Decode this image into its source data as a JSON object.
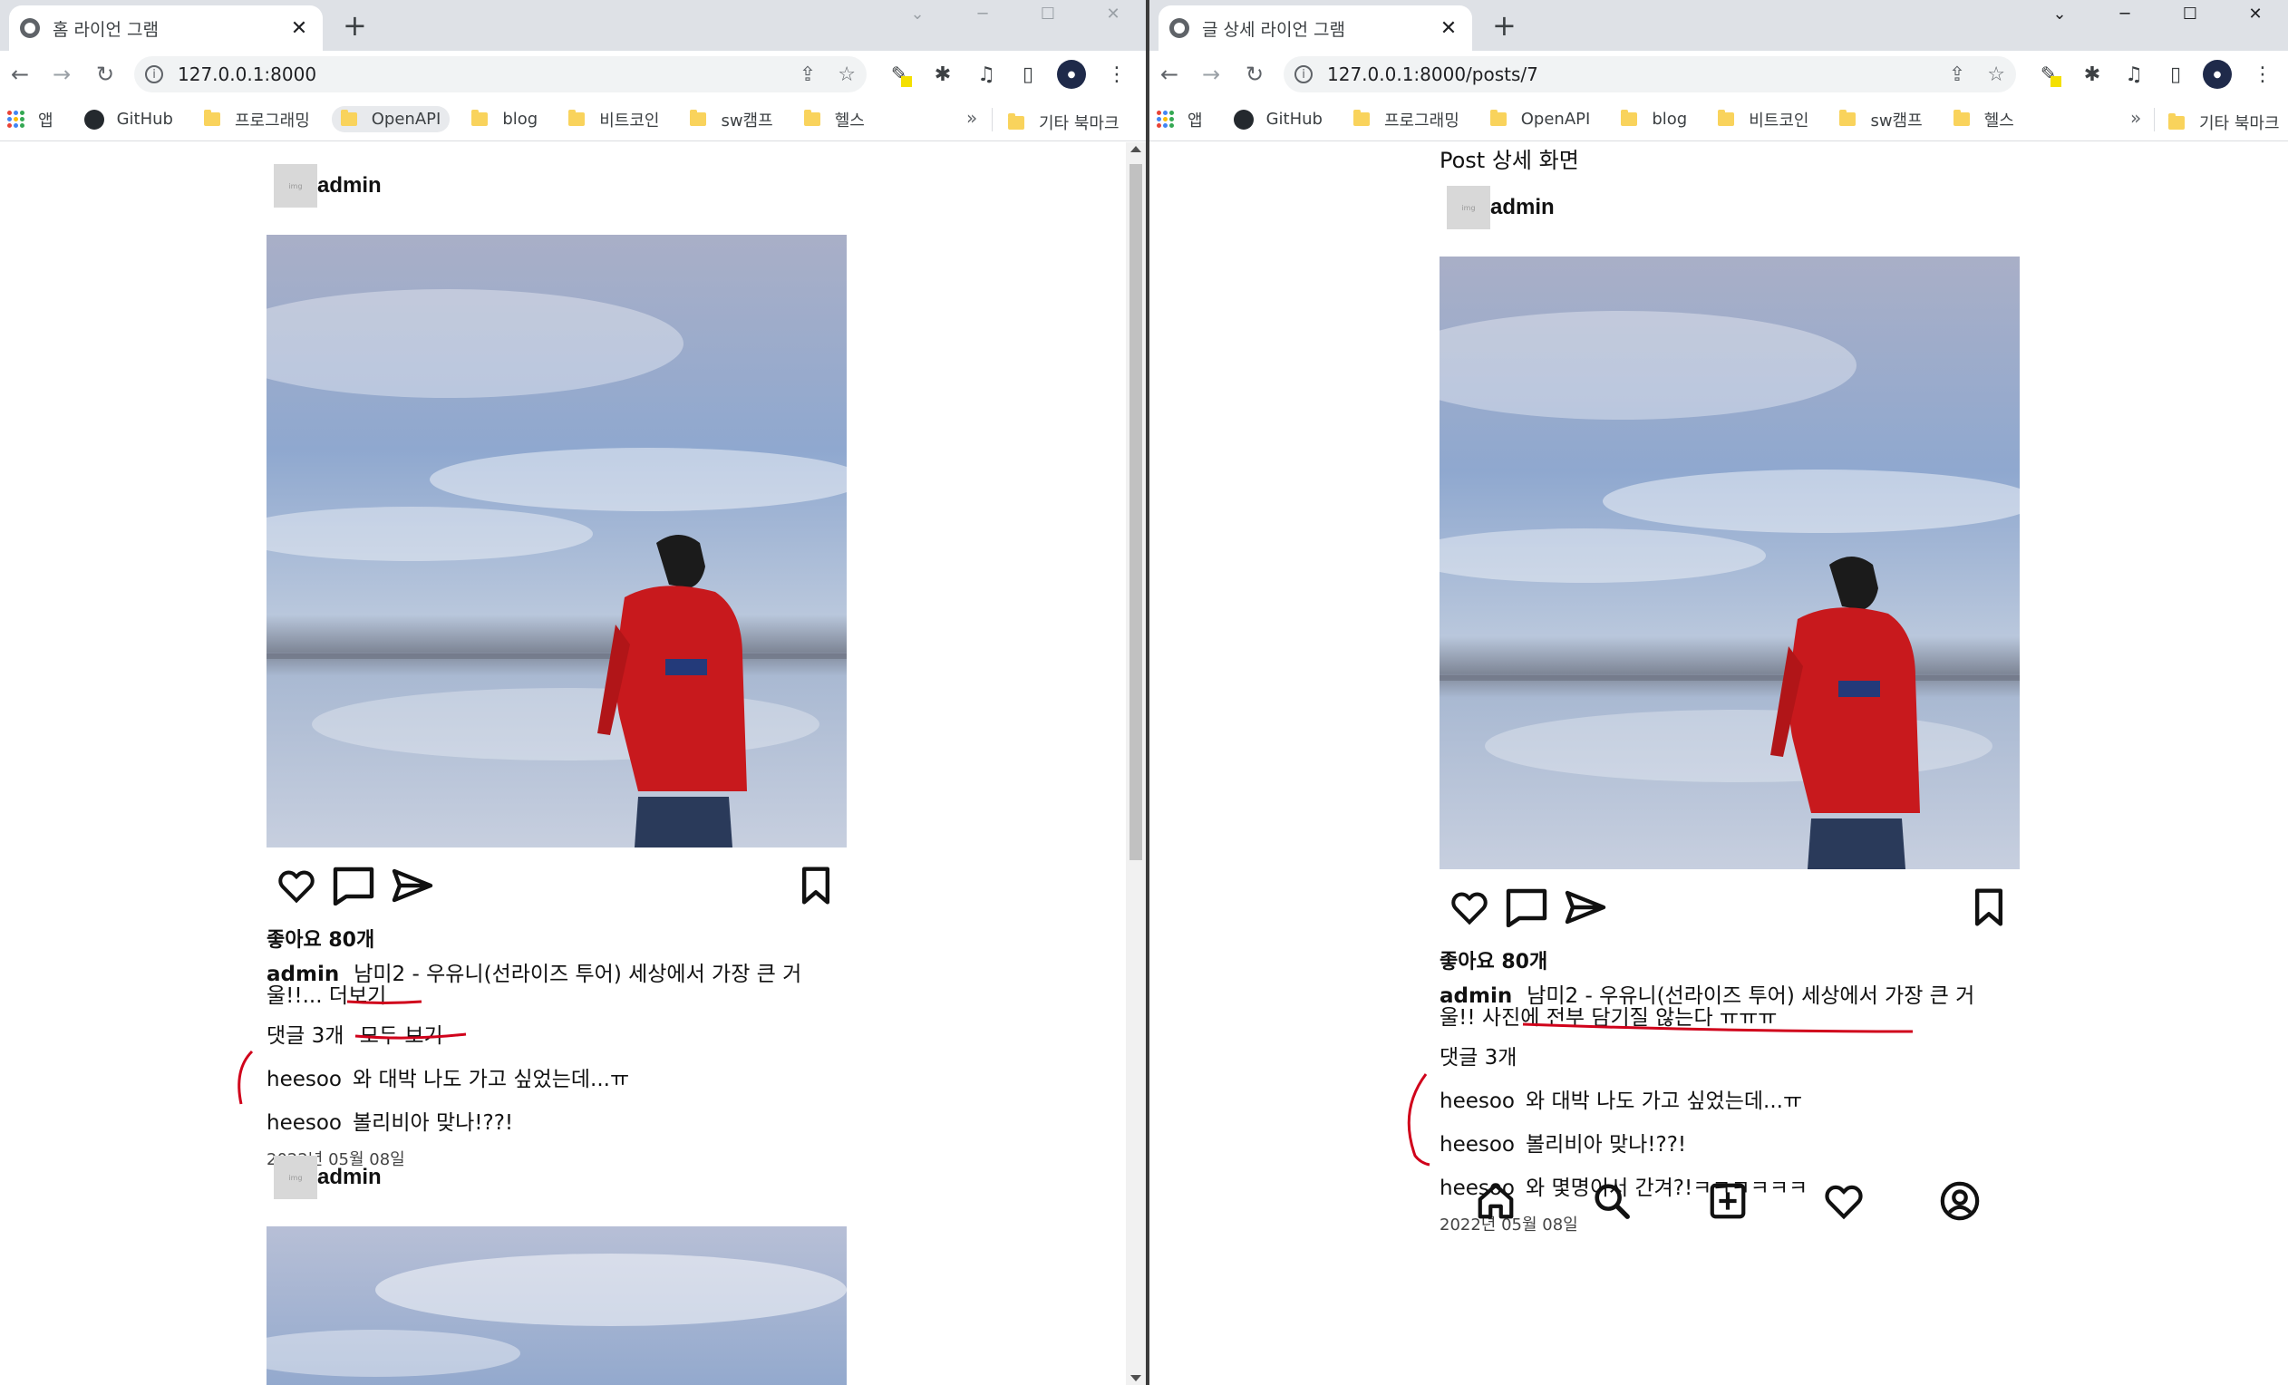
{
  "left_window": {
    "tab_title": "홈 라이언 그램",
    "url": "127.0.0.1:8000",
    "bookmarks": [
      "앱",
      "GitHub",
      "프로그래밍",
      "OpenAPI",
      "blog",
      "비트코인",
      "sw캠프",
      "헬스"
    ],
    "bookmarks_more": "»",
    "other_bookmarks": "기타 북마크",
    "post": {
      "author": "admin",
      "likes": "좋아요 80개",
      "caption_user": "admin",
      "caption_text": "남미2 - 우유니(선라이즈 투어) 세상에서 가장 큰 거울!!...",
      "more_label": "더보기",
      "comment_count": "댓글 3개",
      "view_all_label": "모두 보기",
      "comments": [
        {
          "user": "heesoo",
          "text": "와 대박 나도 가고 싶었는데...ㅠ"
        },
        {
          "user": "heesoo",
          "text": "볼리비아 맞나!??!"
        }
      ],
      "date": "2022년 05월 08일"
    },
    "next_post": {
      "author": "admin"
    }
  },
  "right_window": {
    "tab_title": "글 상세 라이언 그램",
    "url": "127.0.0.1:8000/posts/7",
    "bookmarks": [
      "앱",
      "GitHub",
      "프로그래밍",
      "OpenAPI",
      "blog",
      "비트코인",
      "sw캠프",
      "헬스"
    ],
    "bookmarks_more": "»",
    "other_bookmarks": "기타 북마크",
    "page_heading": "Post 상세 화면",
    "post": {
      "author": "admin",
      "likes": "좋아요 80개",
      "caption_user": "admin",
      "caption_text": "남미2 - 우유니(선라이즈 투어) 세상에서 가장 큰 거울!! 사진에 전부 담기질 않는다 ㅠㅠㅠ",
      "comment_count": "댓글 3개",
      "comments": [
        {
          "user": "heesoo",
          "text": "와 대박 나도 가고 싶었는데...ㅠ"
        },
        {
          "user": "heesoo",
          "text": "볼리비아 맞나!??!"
        },
        {
          "user": "heesoo",
          "text": "와 몇명이서 간겨?!ㅋㅋㅋㅋㅋㅋ"
        }
      ],
      "date": "2022년 05월 08일"
    }
  },
  "icons": {
    "new_tab": "+",
    "close": "✕",
    "back": "←",
    "forward": "→",
    "reload": "↻",
    "share": "⇪",
    "star": "☆",
    "extensions": "✱",
    "media": "♫",
    "sidepanel": "▯",
    "menu": "⋮",
    "window_minimize": "─",
    "window_maximize": "☐",
    "window_close": "✕",
    "tab_search": "⌄"
  },
  "colors": {
    "annotation_red": "#d0021b",
    "hoodie_red": "#c8191d"
  }
}
